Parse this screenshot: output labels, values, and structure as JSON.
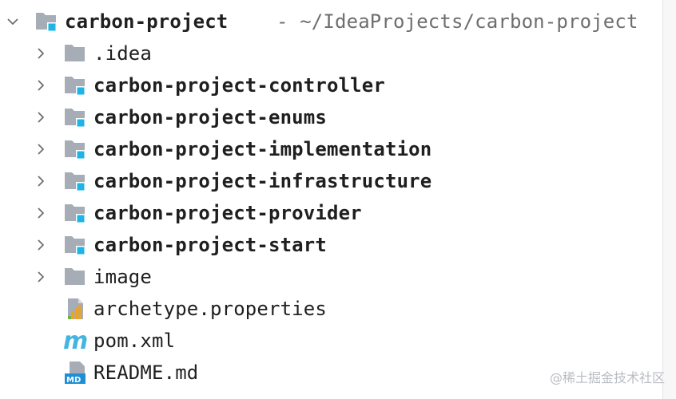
{
  "root": {
    "name": "carbon-project",
    "path": "- ~/IdeaProjects/carbon-project"
  },
  "items": [
    {
      "label": ".idea",
      "type": "folder",
      "module": false
    },
    {
      "label": "carbon-project-controller",
      "type": "folder",
      "module": true
    },
    {
      "label": "carbon-project-enums",
      "type": "folder",
      "module": true
    },
    {
      "label": "carbon-project-implementation",
      "type": "folder",
      "module": true
    },
    {
      "label": "carbon-project-infrastructure",
      "type": "folder",
      "module": true
    },
    {
      "label": "carbon-project-provider",
      "type": "folder",
      "module": true
    },
    {
      "label": "carbon-project-start",
      "type": "folder",
      "module": true
    },
    {
      "label": "image",
      "type": "folder",
      "module": false
    },
    {
      "label": "archetype.properties",
      "type": "properties-file"
    },
    {
      "label": "pom.xml",
      "type": "maven-file"
    },
    {
      "label": "README.md",
      "type": "markdown-file"
    }
  ],
  "watermark": "@稀土掘金技术社区",
  "colors": {
    "folder_gray": "#a7adb6",
    "module_badge": "#1db5e8",
    "maven_m": "#45b5e0",
    "chevron": "#6e6e6e"
  }
}
